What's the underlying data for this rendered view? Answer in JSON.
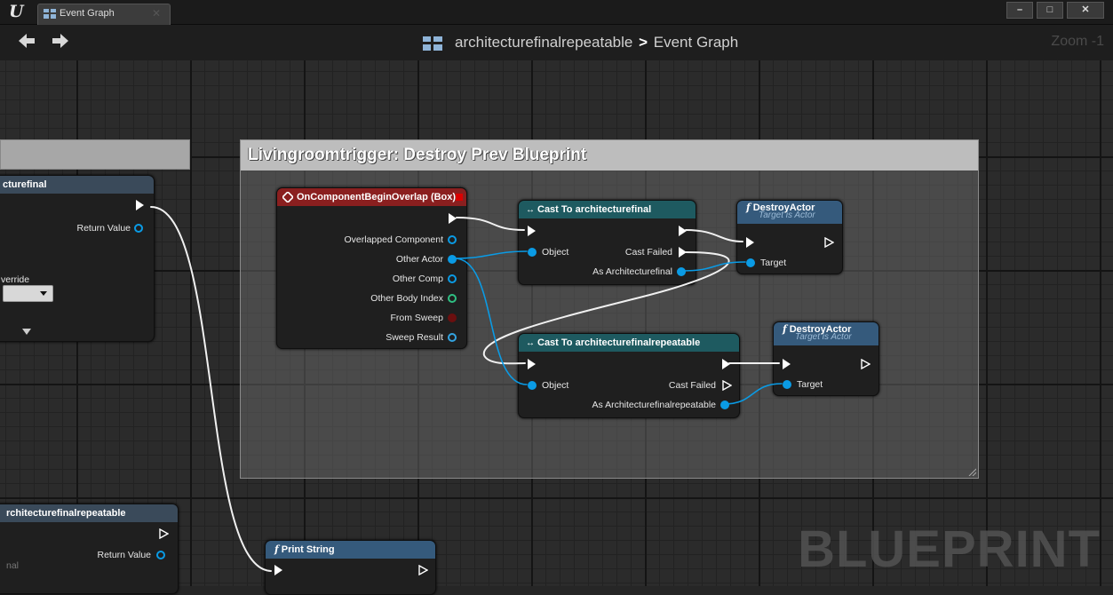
{
  "window": {
    "tab_label": "Event Graph",
    "minimize": "–",
    "maximize": "□",
    "close": "✕"
  },
  "toolbar": {
    "breadcrumb_root": "architecturefinalrepeatable",
    "breadcrumb_sep": ">",
    "breadcrumb_current": "Event Graph",
    "zoom": "Zoom -1"
  },
  "comment": {
    "title": "Livingroomtrigger: Destroy Prev Blueprint"
  },
  "nodes": {
    "left_top": {
      "title": "cturefinal",
      "return_value": "Return Value",
      "override_label": "verride"
    },
    "left_bottom": {
      "title": "rchitecturefinalrepeatable",
      "return_value": "Return Value",
      "pin_label": "nal"
    },
    "event": {
      "title": "OnComponentBeginOverlap (Box)",
      "pins": [
        "Overlapped Component",
        "Other Actor",
        "Other Comp",
        "Other Body Index",
        "From Sweep",
        "Sweep Result"
      ]
    },
    "cast1": {
      "title": "Cast To architecturefinal",
      "object": "Object",
      "cast_failed": "Cast Failed",
      "as_output": "As Architecturefinal"
    },
    "destroy1": {
      "title": "DestroyActor",
      "subtitle": "Target is Actor",
      "target": "Target"
    },
    "cast2": {
      "title": "Cast To architecturefinalrepeatable",
      "object": "Object",
      "cast_failed": "Cast Failed",
      "as_output": "As Architecturefinalrepeatable"
    },
    "destroy2": {
      "title": "DestroyActor",
      "subtitle": "Target is Actor",
      "target": "Target"
    },
    "print_string": {
      "title": "Print String"
    }
  },
  "watermark": "BLUEPRINT",
  "colors": {
    "canvas": "#2b2b2b",
    "event_header": "#8a1f1f",
    "cast_header": "#1e5a60",
    "function_header": "#355a7c",
    "object_pin": "#0a9be5",
    "wire_exec": "#ffffff"
  }
}
